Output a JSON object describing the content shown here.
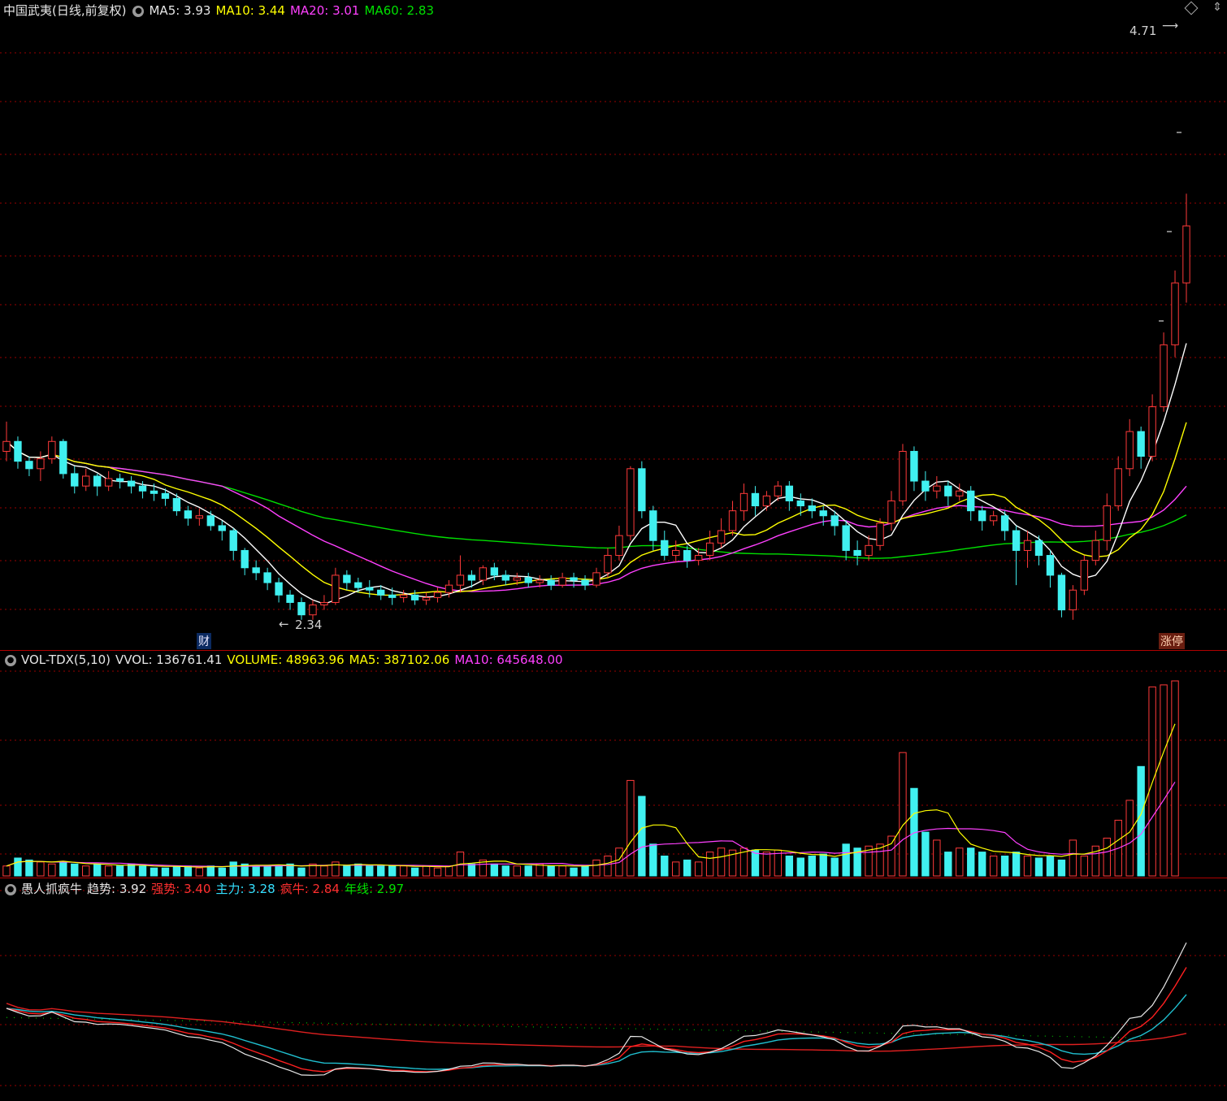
{
  "price_header": {
    "title": "中国武夷(日线,前复权)",
    "ma5": "MA5: 3.93",
    "ma10": "MA10: 3.44",
    "ma20": "MA20: 3.01",
    "ma60": "MA60: 2.83"
  },
  "volume_header": {
    "name": "VOL-TDX(5,10)",
    "vvol": "VVOL: 136761.41",
    "volume": "VOLUME: 48963.96",
    "ma5": "MA5: 387102.06",
    "ma10": "MA10: 645648.00"
  },
  "indicator_header": {
    "name": "愚人抓疯牛",
    "trend": "趋势: 3.92",
    "strong": "强势: 3.40",
    "main": "主力: 3.28",
    "bull": "疯牛: 2.84",
    "year": "年线: 2.97"
  },
  "annotations": {
    "high_label": "4.71",
    "low_label": "2.34",
    "tag_cai": "财",
    "tag_zt": "涨停"
  },
  "colors": {
    "up": "#ff3a3a",
    "down": "#40f0f0",
    "ma5": "#ffffff",
    "ma10": "#ffff00",
    "ma20": "#ff40ff",
    "ma60": "#00e000",
    "grid": "#9a0000"
  },
  "chart_data": {
    "type": "candlestick",
    "price_range": [
      2.3,
      4.75
    ],
    "candles": [
      [
        3.02,
        3.06,
        2.98,
        3.14
      ],
      [
        3.06,
        2.98,
        2.95,
        3.08
      ],
      [
        2.98,
        2.95,
        2.92,
        3.0
      ],
      [
        2.95,
        2.99,
        2.9,
        3.02
      ],
      [
        2.99,
        3.06,
        2.97,
        3.08
      ],
      [
        3.06,
        2.93,
        2.91,
        3.07
      ],
      [
        2.93,
        2.88,
        2.85,
        2.96
      ],
      [
        2.88,
        2.92,
        2.86,
        2.95
      ],
      [
        2.92,
        2.88,
        2.84,
        2.93
      ],
      [
        2.88,
        2.91,
        2.86,
        2.94
      ],
      [
        2.91,
        2.9,
        2.87,
        2.93
      ],
      [
        2.9,
        2.88,
        2.85,
        2.92
      ],
      [
        2.88,
        2.86,
        2.83,
        2.9
      ],
      [
        2.86,
        2.85,
        2.82,
        2.89
      ],
      [
        2.85,
        2.83,
        2.8,
        2.87
      ],
      [
        2.83,
        2.78,
        2.76,
        2.85
      ],
      [
        2.78,
        2.75,
        2.72,
        2.8
      ],
      [
        2.75,
        2.76,
        2.72,
        2.79
      ],
      [
        2.76,
        2.72,
        2.7,
        2.78
      ],
      [
        2.72,
        2.7,
        2.66,
        2.74
      ],
      [
        2.7,
        2.62,
        2.58,
        2.71
      ],
      [
        2.62,
        2.55,
        2.52,
        2.63
      ],
      [
        2.55,
        2.53,
        2.5,
        2.58
      ],
      [
        2.53,
        2.49,
        2.46,
        2.55
      ],
      [
        2.49,
        2.44,
        2.41,
        2.51
      ],
      [
        2.44,
        2.41,
        2.38,
        2.46
      ],
      [
        2.41,
        2.36,
        2.34,
        2.43
      ],
      [
        2.36,
        2.4,
        2.34,
        2.42
      ],
      [
        2.4,
        2.41,
        2.38,
        2.44
      ],
      [
        2.41,
        2.52,
        2.4,
        2.55
      ],
      [
        2.52,
        2.49,
        2.46,
        2.54
      ],
      [
        2.49,
        2.47,
        2.45,
        2.51
      ],
      [
        2.47,
        2.46,
        2.43,
        2.5
      ],
      [
        2.46,
        2.44,
        2.42,
        2.48
      ],
      [
        2.44,
        2.43,
        2.4,
        2.47
      ],
      [
        2.43,
        2.44,
        2.41,
        2.46
      ],
      [
        2.44,
        2.42,
        2.4,
        2.46
      ],
      [
        2.42,
        2.43,
        2.4,
        2.45
      ],
      [
        2.43,
        2.45,
        2.41,
        2.47
      ],
      [
        2.45,
        2.48,
        2.43,
        2.5
      ],
      [
        2.48,
        2.52,
        2.45,
        2.6
      ],
      [
        2.52,
        2.5,
        2.47,
        2.54
      ],
      [
        2.5,
        2.55,
        2.48,
        2.56
      ],
      [
        2.55,
        2.52,
        2.5,
        2.57
      ],
      [
        2.52,
        2.5,
        2.48,
        2.54
      ],
      [
        2.5,
        2.51,
        2.48,
        2.53
      ],
      [
        2.51,
        2.49,
        2.47,
        2.53
      ],
      [
        2.49,
        2.5,
        2.47,
        2.52
      ],
      [
        2.5,
        2.48,
        2.46,
        2.52
      ],
      [
        2.48,
        2.51,
        2.47,
        2.53
      ],
      [
        2.51,
        2.5,
        2.47,
        2.53
      ],
      [
        2.5,
        2.48,
        2.46,
        2.52
      ],
      [
        2.48,
        2.53,
        2.47,
        2.55
      ],
      [
        2.53,
        2.6,
        2.51,
        2.63
      ],
      [
        2.6,
        2.68,
        2.58,
        2.72
      ],
      [
        2.68,
        2.95,
        2.66,
        2.96
      ],
      [
        2.95,
        2.78,
        2.75,
        2.98
      ],
      [
        2.78,
        2.66,
        2.62,
        2.8
      ],
      [
        2.66,
        2.6,
        2.58,
        2.7
      ],
      [
        2.6,
        2.62,
        2.57,
        2.66
      ],
      [
        2.62,
        2.58,
        2.55,
        2.64
      ],
      [
        2.58,
        2.6,
        2.56,
        2.63
      ],
      [
        2.6,
        2.65,
        2.58,
        2.7
      ],
      [
        2.65,
        2.7,
        2.63,
        2.75
      ],
      [
        2.7,
        2.78,
        2.68,
        2.82
      ],
      [
        2.78,
        2.85,
        2.74,
        2.89
      ],
      [
        2.85,
        2.8,
        2.76,
        2.88
      ],
      [
        2.8,
        2.84,
        2.78,
        2.86
      ],
      [
        2.84,
        2.88,
        2.82,
        2.9
      ],
      [
        2.88,
        2.82,
        2.78,
        2.9
      ],
      [
        2.82,
        2.8,
        2.76,
        2.85
      ],
      [
        2.8,
        2.78,
        2.75,
        2.83
      ],
      [
        2.78,
        2.76,
        2.72,
        2.8
      ],
      [
        2.76,
        2.72,
        2.68,
        2.78
      ],
      [
        2.72,
        2.62,
        2.58,
        2.74
      ],
      [
        2.62,
        2.6,
        2.56,
        2.66
      ],
      [
        2.6,
        2.64,
        2.58,
        2.68
      ],
      [
        2.64,
        2.73,
        2.62,
        2.75
      ],
      [
        2.73,
        2.82,
        2.7,
        2.86
      ],
      [
        2.82,
        3.02,
        2.8,
        3.05
      ],
      [
        3.02,
        2.9,
        2.86,
        3.04
      ],
      [
        2.9,
        2.86,
        2.82,
        2.94
      ],
      [
        2.86,
        2.88,
        2.83,
        2.92
      ],
      [
        2.88,
        2.84,
        2.8,
        2.9
      ],
      [
        2.84,
        2.86,
        2.82,
        2.89
      ],
      [
        2.86,
        2.78,
        2.74,
        2.88
      ],
      [
        2.78,
        2.74,
        2.7,
        2.8
      ],
      [
        2.74,
        2.76,
        2.72,
        2.78
      ],
      [
        2.76,
        2.7,
        2.66,
        2.78
      ],
      [
        2.7,
        2.62,
        2.48,
        2.72
      ],
      [
        2.62,
        2.66,
        2.55,
        2.7
      ],
      [
        2.66,
        2.6,
        2.56,
        2.68
      ],
      [
        2.6,
        2.52,
        2.47,
        2.62
      ],
      [
        2.52,
        2.38,
        2.35,
        2.53
      ],
      [
        2.38,
        2.46,
        2.34,
        2.48
      ],
      [
        2.46,
        2.58,
        2.44,
        2.6
      ],
      [
        2.58,
        2.66,
        2.56,
        2.7
      ],
      [
        2.66,
        2.8,
        2.62,
        2.85
      ],
      [
        2.8,
        2.95,
        2.78,
        3.0
      ],
      [
        2.95,
        3.1,
        2.92,
        3.15
      ],
      [
        3.1,
        3.0,
        2.95,
        3.12
      ],
      [
        3.0,
        3.2,
        2.98,
        3.25
      ],
      [
        3.2,
        3.45,
        3.18,
        3.5
      ],
      [
        3.45,
        3.7,
        3.4,
        3.75
      ],
      [
        3.7,
        3.93,
        3.62,
        4.06
      ]
    ],
    "volume": [
      5,
      9,
      8,
      7,
      6,
      7,
      6,
      5,
      6,
      5,
      5,
      6,
      5,
      4,
      4,
      5,
      5,
      4,
      5,
      4,
      7,
      6,
      5,
      5,
      5,
      6,
      4,
      6,
      5,
      7,
      5,
      6,
      5,
      5,
      5,
      5,
      4,
      5,
      4,
      5,
      12,
      6,
      8,
      6,
      5,
      5,
      5,
      6,
      5,
      5,
      4,
      5,
      8,
      10,
      14,
      48,
      40,
      16,
      10,
      7,
      8,
      7,
      12,
      14,
      13,
      14,
      13,
      12,
      13,
      10,
      9,
      10,
      11,
      9,
      16,
      14,
      15,
      16,
      20,
      62,
      44,
      22,
      18,
      12,
      14,
      14,
      12,
      10,
      10,
      12,
      10,
      9,
      10,
      8,
      18,
      10,
      15,
      19,
      28,
      38,
      55,
      95,
      96,
      98
    ]
  }
}
